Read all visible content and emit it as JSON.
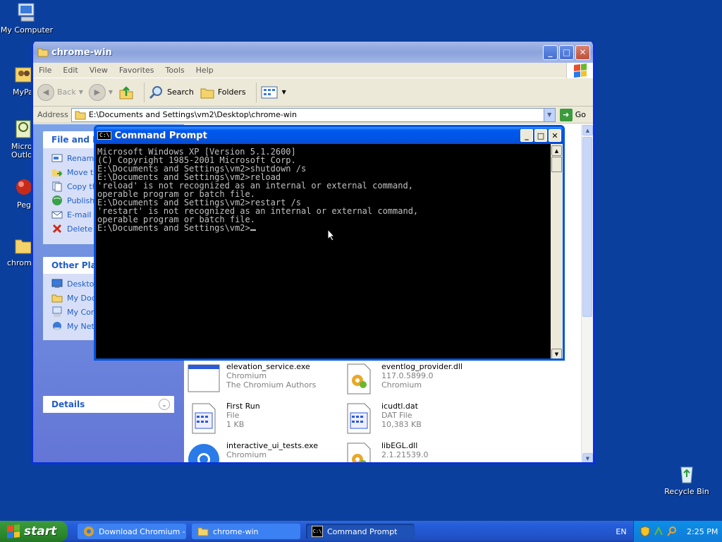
{
  "desktop": {
    "icons": [
      {
        "label": "My Computer"
      },
      {
        "label": "MyPa"
      },
      {
        "label": "Micros Outlo"
      },
      {
        "label": "Peg"
      },
      {
        "label": "chrome"
      },
      {
        "label": "Recycle Bin"
      }
    ]
  },
  "explorer": {
    "title": "chrome-win",
    "menu": [
      "File",
      "Edit",
      "View",
      "Favorites",
      "Tools",
      "Help"
    ],
    "toolbar": {
      "back": "Back",
      "search": "Search",
      "folders": "Folders"
    },
    "address": {
      "label": "Address",
      "value": "E:\\Documents and Settings\\vm2\\Desktop\\chrome-win",
      "go": "Go"
    },
    "tasks": {
      "title": "File and Fo",
      "items": [
        "Rename",
        "Move th",
        "Copy th",
        "Publish",
        "E-mail t",
        "Delete"
      ]
    },
    "other_places": {
      "title": "Other Plac",
      "items": [
        "Desktop",
        "My Doc",
        "My Com",
        "My Netw"
      ]
    },
    "details": {
      "title": "Details"
    },
    "files": [
      {
        "name": "elevation_service.exe",
        "line2": "Chromium",
        "line3": "The Chromium Authors"
      },
      {
        "name": "eventlog_provider.dll",
        "line2": "117.0.5899.0",
        "line3": "Chromium"
      },
      {
        "name": "First Run",
        "line2": "File",
        "line3": "1 KB"
      },
      {
        "name": "icudtl.dat",
        "line2": "DAT File",
        "line3": "10,383 KB"
      },
      {
        "name": "interactive_ui_tests.exe",
        "line2": "Chromium",
        "line3": ""
      },
      {
        "name": "libEGL.dll",
        "line2": "2.1.21539.0",
        "line3": ""
      }
    ]
  },
  "cmd": {
    "title": "Command Prompt",
    "icon_text": "C:\\",
    "lines": [
      "Microsoft Windows XP [Version 5.1.2600]",
      "(C) Copyright 1985-2001 Microsoft Corp.",
      "",
      "E:\\Documents and Settings\\vm2>shutdown /s",
      "",
      "",
      "E:\\Documents and Settings\\vm2>reload",
      "'reload' is not recognized as an internal or external command,",
      "operable program or batch file.",
      "",
      "E:\\Documents and Settings\\vm2>restart /s",
      "'restart' is not recognized as an internal or external command,",
      "operable program or batch file.",
      "",
      "E:\\Documents and Settings\\vm2>"
    ]
  },
  "taskbar": {
    "start": "start",
    "tasks": [
      {
        "label": "Download Chromium -..."
      },
      {
        "label": "chrome-win"
      },
      {
        "label": "Command Prompt"
      }
    ],
    "language": "EN",
    "clock": "2:25 PM"
  },
  "colors": {
    "desktop": "#0a3f9e",
    "xp_blue": "#0054e3",
    "start_green": "#2c8a2c"
  }
}
